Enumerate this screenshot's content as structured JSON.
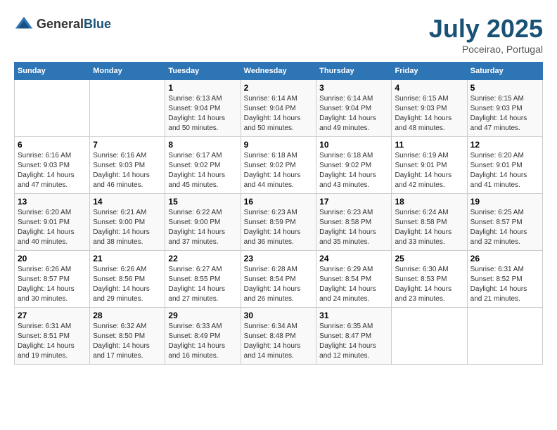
{
  "logo": {
    "general": "General",
    "blue": "Blue"
  },
  "header": {
    "month": "July 2025",
    "location": "Poceirao, Portugal"
  },
  "weekdays": [
    "Sunday",
    "Monday",
    "Tuesday",
    "Wednesday",
    "Thursday",
    "Friday",
    "Saturday"
  ],
  "weeks": [
    [
      {
        "day": "",
        "info": ""
      },
      {
        "day": "",
        "info": ""
      },
      {
        "day": "1",
        "info": "Sunrise: 6:13 AM\nSunset: 9:04 PM\nDaylight: 14 hours and 50 minutes."
      },
      {
        "day": "2",
        "info": "Sunrise: 6:14 AM\nSunset: 9:04 PM\nDaylight: 14 hours and 50 minutes."
      },
      {
        "day": "3",
        "info": "Sunrise: 6:14 AM\nSunset: 9:04 PM\nDaylight: 14 hours and 49 minutes."
      },
      {
        "day": "4",
        "info": "Sunrise: 6:15 AM\nSunset: 9:03 PM\nDaylight: 14 hours and 48 minutes."
      },
      {
        "day": "5",
        "info": "Sunrise: 6:15 AM\nSunset: 9:03 PM\nDaylight: 14 hours and 47 minutes."
      }
    ],
    [
      {
        "day": "6",
        "info": "Sunrise: 6:16 AM\nSunset: 9:03 PM\nDaylight: 14 hours and 47 minutes."
      },
      {
        "day": "7",
        "info": "Sunrise: 6:16 AM\nSunset: 9:03 PM\nDaylight: 14 hours and 46 minutes."
      },
      {
        "day": "8",
        "info": "Sunrise: 6:17 AM\nSunset: 9:02 PM\nDaylight: 14 hours and 45 minutes."
      },
      {
        "day": "9",
        "info": "Sunrise: 6:18 AM\nSunset: 9:02 PM\nDaylight: 14 hours and 44 minutes."
      },
      {
        "day": "10",
        "info": "Sunrise: 6:18 AM\nSunset: 9:02 PM\nDaylight: 14 hours and 43 minutes."
      },
      {
        "day": "11",
        "info": "Sunrise: 6:19 AM\nSunset: 9:01 PM\nDaylight: 14 hours and 42 minutes."
      },
      {
        "day": "12",
        "info": "Sunrise: 6:20 AM\nSunset: 9:01 PM\nDaylight: 14 hours and 41 minutes."
      }
    ],
    [
      {
        "day": "13",
        "info": "Sunrise: 6:20 AM\nSunset: 9:01 PM\nDaylight: 14 hours and 40 minutes."
      },
      {
        "day": "14",
        "info": "Sunrise: 6:21 AM\nSunset: 9:00 PM\nDaylight: 14 hours and 38 minutes."
      },
      {
        "day": "15",
        "info": "Sunrise: 6:22 AM\nSunset: 9:00 PM\nDaylight: 14 hours and 37 minutes."
      },
      {
        "day": "16",
        "info": "Sunrise: 6:23 AM\nSunset: 8:59 PM\nDaylight: 14 hours and 36 minutes."
      },
      {
        "day": "17",
        "info": "Sunrise: 6:23 AM\nSunset: 8:58 PM\nDaylight: 14 hours and 35 minutes."
      },
      {
        "day": "18",
        "info": "Sunrise: 6:24 AM\nSunset: 8:58 PM\nDaylight: 14 hours and 33 minutes."
      },
      {
        "day": "19",
        "info": "Sunrise: 6:25 AM\nSunset: 8:57 PM\nDaylight: 14 hours and 32 minutes."
      }
    ],
    [
      {
        "day": "20",
        "info": "Sunrise: 6:26 AM\nSunset: 8:57 PM\nDaylight: 14 hours and 30 minutes."
      },
      {
        "day": "21",
        "info": "Sunrise: 6:26 AM\nSunset: 8:56 PM\nDaylight: 14 hours and 29 minutes."
      },
      {
        "day": "22",
        "info": "Sunrise: 6:27 AM\nSunset: 8:55 PM\nDaylight: 14 hours and 27 minutes."
      },
      {
        "day": "23",
        "info": "Sunrise: 6:28 AM\nSunset: 8:54 PM\nDaylight: 14 hours and 26 minutes."
      },
      {
        "day": "24",
        "info": "Sunrise: 6:29 AM\nSunset: 8:54 PM\nDaylight: 14 hours and 24 minutes."
      },
      {
        "day": "25",
        "info": "Sunrise: 6:30 AM\nSunset: 8:53 PM\nDaylight: 14 hours and 23 minutes."
      },
      {
        "day": "26",
        "info": "Sunrise: 6:31 AM\nSunset: 8:52 PM\nDaylight: 14 hours and 21 minutes."
      }
    ],
    [
      {
        "day": "27",
        "info": "Sunrise: 6:31 AM\nSunset: 8:51 PM\nDaylight: 14 hours and 19 minutes."
      },
      {
        "day": "28",
        "info": "Sunrise: 6:32 AM\nSunset: 8:50 PM\nDaylight: 14 hours and 17 minutes."
      },
      {
        "day": "29",
        "info": "Sunrise: 6:33 AM\nSunset: 8:49 PM\nDaylight: 14 hours and 16 minutes."
      },
      {
        "day": "30",
        "info": "Sunrise: 6:34 AM\nSunset: 8:48 PM\nDaylight: 14 hours and 14 minutes."
      },
      {
        "day": "31",
        "info": "Sunrise: 6:35 AM\nSunset: 8:47 PM\nDaylight: 14 hours and 12 minutes."
      },
      {
        "day": "",
        "info": ""
      },
      {
        "day": "",
        "info": ""
      }
    ]
  ]
}
